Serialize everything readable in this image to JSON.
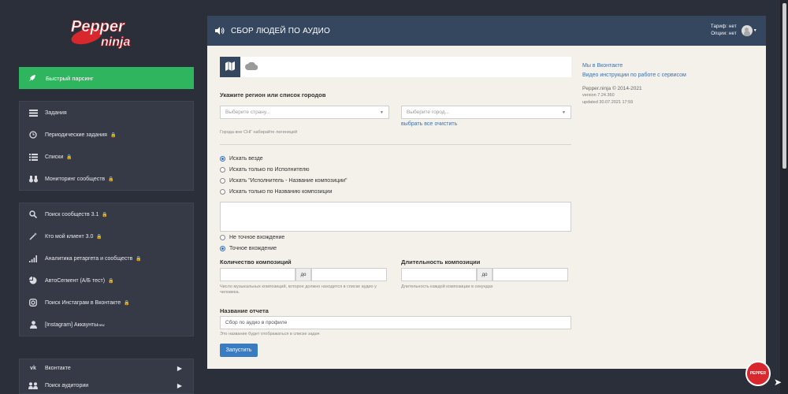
{
  "sidebar": {
    "logo_text": "Pepper ninja",
    "fast_parse": "Быстрый парсинг",
    "group1": [
      {
        "label": "Задания",
        "icon": "tasks-icon",
        "locked": false
      },
      {
        "label": "Периодические задания",
        "icon": "clock-icon",
        "locked": true
      },
      {
        "label": "Списки",
        "icon": "list-icon",
        "locked": true
      },
      {
        "label": "Мониторинг сообществ",
        "icon": "binoculars-icon",
        "locked": true
      }
    ],
    "group2": [
      {
        "label": "Поиск сообществ 3.1",
        "icon": "search-icon",
        "locked": true
      },
      {
        "label": "Кто мой клиент 3.0",
        "icon": "magic-wand-icon",
        "locked": true
      },
      {
        "label": "Аналитика ретаргета и сообществ",
        "icon": "signal-icon",
        "locked": true
      },
      {
        "label": "АвтоСегмент (А/Б тест)",
        "icon": "pie-chart-icon",
        "locked": true
      },
      {
        "label": "Поиск Инстаграм в Вконтакте",
        "icon": "instagram-icon",
        "locked": true
      },
      {
        "label": "[Instagram] Аккаунты",
        "icon": "user-icon",
        "locked": false,
        "sup": "new"
      }
    ],
    "group3": [
      {
        "label": "Вконтакте",
        "icon": "vk-icon"
      },
      {
        "label": "Поиск аудитории",
        "icon": "users-icon"
      }
    ]
  },
  "header": {
    "title": "СБОР ЛЮДЕЙ ПО АУДИО",
    "tariff": "Тариф: нет",
    "options": "Опции: нет"
  },
  "form": {
    "region_label": "Укажите регион или список городов",
    "country_placeholder": "Выберите страну...",
    "city_placeholder": "Выберите город...",
    "select_all": "выбрать все",
    "clear": "очистить",
    "cities_hint": "Города вне СНГ набирайте латиницей",
    "search_modes": [
      {
        "label": "Искать везде",
        "selected": true
      },
      {
        "label": "Искать только по Исполнителю",
        "selected": false
      },
      {
        "label": "Искать \"Исполнитель - Название композиции\"",
        "selected": false
      },
      {
        "label": "Искать только по Названию композиции",
        "selected": false
      }
    ],
    "match_modes": [
      {
        "label": "Не точное вхождение",
        "selected": false
      },
      {
        "label": "Точное вхождение",
        "selected": true
      }
    ],
    "count_label": "Количество композиций",
    "count_hint": "Число музыкальных композиций, которое должно находится в списке аудио у человека.",
    "duration_label": "Длительность композиции",
    "duration_hint": "Длительность каждой композиции в секундах",
    "to_label": "до",
    "report_label": "Название отчета",
    "report_value": "Сбор по аудио в профиле",
    "report_hint": "Это название будет отображаться в списке задач",
    "run_button": "Запустить"
  },
  "info": {
    "vk_link": "Мы в Вконтакте",
    "video_link": "Видео инструкции по работе с сервисом",
    "copyright": "Pepper.ninja © 2014-2021",
    "version": "version 7.24.360",
    "updated": "updated 30.07.2021 17:59"
  },
  "badge": "PEPPER",
  "colors": {
    "accent": "#35475f",
    "green": "#2fb55e",
    "link": "#3b73b3",
    "button": "#3a7cc1"
  }
}
